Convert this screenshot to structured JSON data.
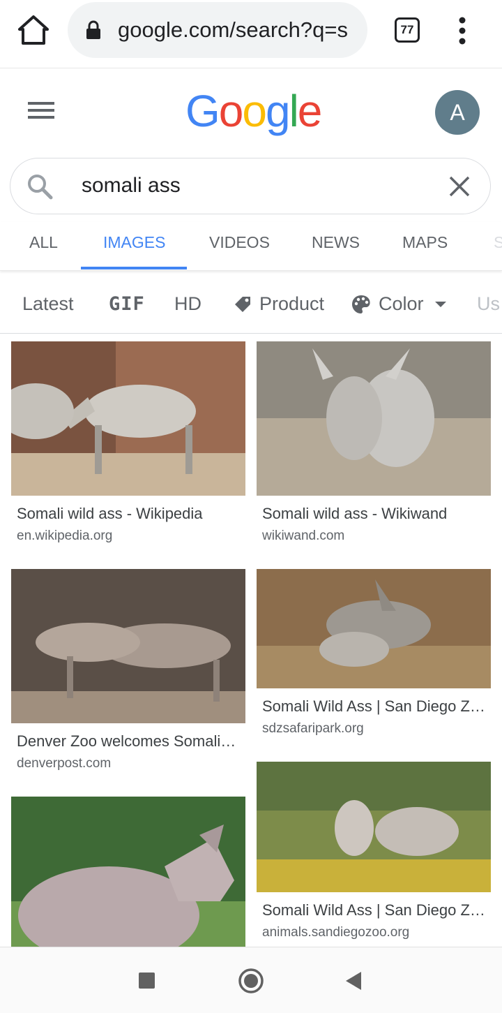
{
  "browser": {
    "url": "google.com/search?q=s",
    "tab_count": "77"
  },
  "header": {
    "logo_letters": [
      "G",
      "o",
      "o",
      "g",
      "l",
      "e"
    ],
    "logo_colors": [
      "#4285f4",
      "#ea4335",
      "#fbbc05",
      "#4285f4",
      "#34a853",
      "#ea4335"
    ],
    "avatar_initial": "A"
  },
  "search": {
    "query": "somali ass"
  },
  "tabs": [
    {
      "label": "ALL",
      "active": false
    },
    {
      "label": "IMAGES",
      "active": true
    },
    {
      "label": "VIDEOS",
      "active": false
    },
    {
      "label": "NEWS",
      "active": false
    },
    {
      "label": "MAPS",
      "active": false
    },
    {
      "label": "S",
      "active": false
    }
  ],
  "chips": [
    {
      "label": "Latest"
    },
    {
      "label": "GIF"
    },
    {
      "label": "HD"
    },
    {
      "label": "Product",
      "icon": "tag-icon"
    },
    {
      "label": "Color",
      "icon": "palette-icon"
    },
    {
      "label": "Us"
    }
  ],
  "results": [
    {
      "title": "Somali wild ass - Wikipedia",
      "source": "en.wikipedia.org"
    },
    {
      "title": "Somali wild ass - Wikiwand",
      "source": "wikiwand.com"
    },
    {
      "title": "Denver Zoo welcomes Somali…",
      "source": "denverpost.com"
    },
    {
      "title": "Somali Wild Ass | San Diego Z…",
      "source": "sdzsafaripark.org"
    },
    {
      "title": "Somali Wild Ass | San Diego Z…",
      "source": "animals.sandiegozoo.org"
    }
  ]
}
